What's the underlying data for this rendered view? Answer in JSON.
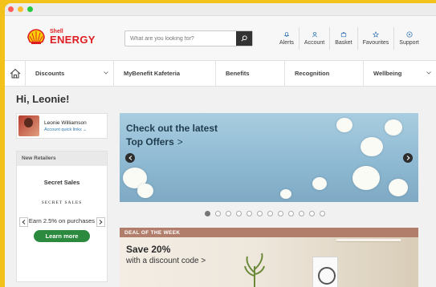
{
  "brand": {
    "shell": "Shell",
    "energy": "ENERGY"
  },
  "search": {
    "placeholder": "What are you looking for?"
  },
  "header_actions": [
    {
      "label": "Alerts",
      "icon": "bell-icon"
    },
    {
      "label": "Account",
      "icon": "user-icon"
    },
    {
      "label": "Basket",
      "icon": "basket-icon"
    },
    {
      "label": "Favourites",
      "icon": "star-icon"
    },
    {
      "label": "Support",
      "icon": "help-icon"
    }
  ],
  "nav": {
    "items": [
      {
        "label": "Discounts",
        "chevron": true
      },
      {
        "label": "MyBenefit Kafeteria",
        "chevron": false
      },
      {
        "label": "Benefits",
        "chevron": false
      },
      {
        "label": "Recognition",
        "chevron": false
      },
      {
        "label": "Wellbeing",
        "chevron": true
      }
    ]
  },
  "greeting": "Hi, Leonie!",
  "account": {
    "name": "Leonie Williamson",
    "links": "Account quick links ⌄"
  },
  "retailers": {
    "title": "New Retailers",
    "name": "Secret Sales",
    "logo_text": "SECRET SALES",
    "earn": "Earn 2.5% on purchases",
    "cta": "Learn more"
  },
  "hero": {
    "line1": "Check out the latest",
    "line2": "Top Offers",
    "arrow": ">"
  },
  "carousel": {
    "count": 12,
    "active": 0
  },
  "deal": {
    "badge": "DEAL OF THE WEEK",
    "headline": "Save 20%",
    "subline": "with a discount code >"
  },
  "colors": {
    "brand_red": "#dd1d21",
    "cta_green": "#2b8a3e",
    "deal_bar": "#b27e6c",
    "frame": "#f2c21b"
  }
}
